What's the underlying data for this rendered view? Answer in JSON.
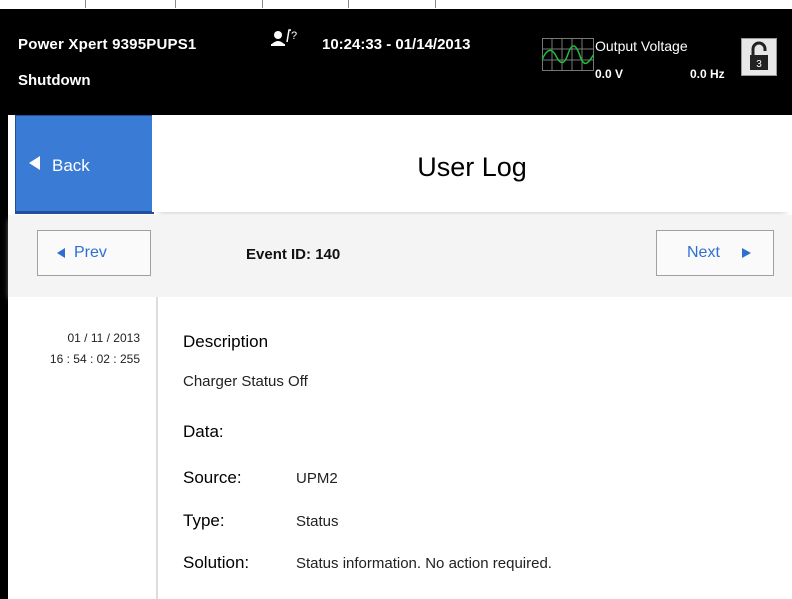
{
  "header": {
    "model": "Power Xpert 9395PUPS1",
    "state": "Shutdown",
    "user_level": "?",
    "datetime": "10:24:33 - 01/14/2013",
    "output_label": "Output Voltage",
    "output_voltage": "0.0 V",
    "output_freq": "0.0 Hz",
    "lock_level": "3"
  },
  "nav": {
    "back_label": "Back",
    "page_title": "User Log",
    "prev_label": "Prev",
    "next_label": "Next",
    "event_id_label": "Event ID:",
    "event_id": "140"
  },
  "entry": {
    "date": "01 / 11 / 2013",
    "time": "16 : 54 : 02 : 255",
    "description_label": "Description",
    "description": "Charger Status Off",
    "data_label": "Data:",
    "source_label": "Source:",
    "source": "UPM2",
    "type_label": "Type:",
    "type": "Status",
    "solution_label": "Solution:",
    "solution": "Status information. No action required."
  },
  "colors": {
    "back_button": "#3a7bd5",
    "nav_text": "#2f6fd0",
    "waveform": "#1fbf3a"
  }
}
